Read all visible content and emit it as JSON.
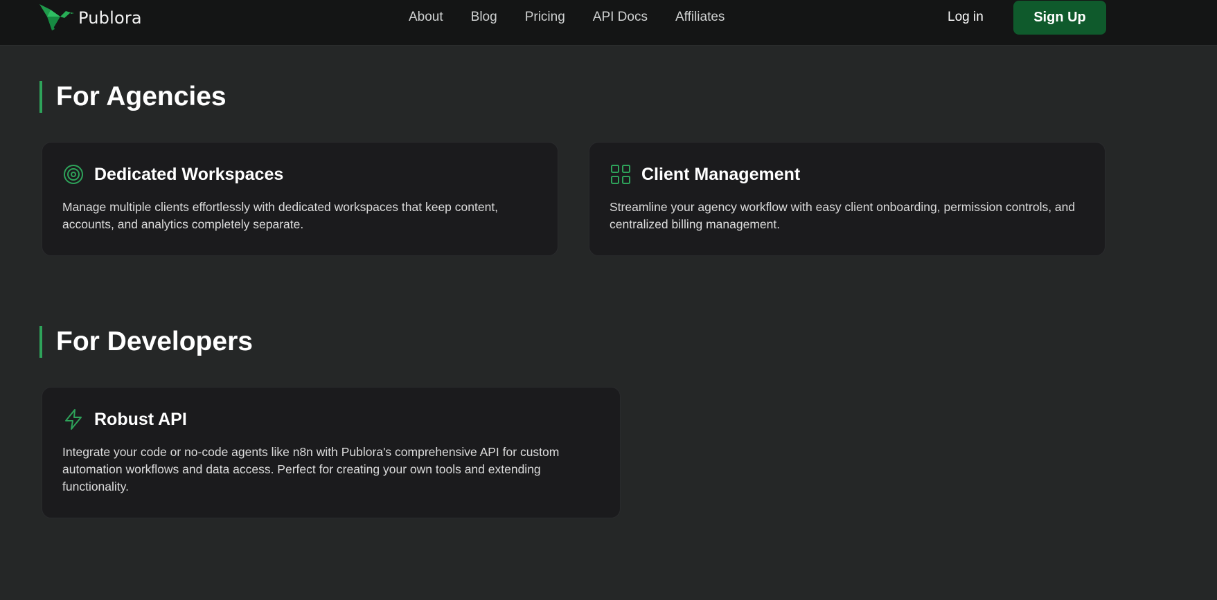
{
  "nav": {
    "brand": "Publora",
    "links": [
      "About",
      "Blog",
      "Pricing",
      "API Docs",
      "Affiliates"
    ],
    "login": "Log in",
    "signup": "Sign Up"
  },
  "sections": [
    {
      "heading": "For Agencies",
      "cards": [
        {
          "icon": "target-icon",
          "title": "Dedicated Workspaces",
          "description": "Manage multiple clients effortlessly with dedicated workspaces that keep content, accounts, and analytics completely separate."
        },
        {
          "icon": "grid-icon",
          "title": "Client Management",
          "description": "Streamline your agency workflow with easy client onboarding, permission controls, and centralized billing management."
        }
      ]
    },
    {
      "heading": "For Developers",
      "cards": [
        {
          "icon": "lightning-icon",
          "title": "Robust API",
          "description": "Integrate your code or no-code agents like n8n with Publora's comprehensive API for custom automation workflows and data access. Perfect for creating your own tools and extending functionality."
        }
      ]
    }
  ],
  "colors": {
    "page_background": "#252727",
    "navbar_background": "#141515",
    "card_background": "#1b1b1d",
    "accent_green": "#2ea35a",
    "signup_button": "#0f5a2c"
  }
}
